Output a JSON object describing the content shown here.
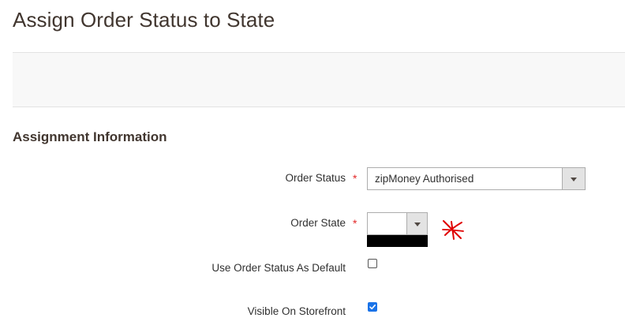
{
  "page": {
    "title": "Assign Order Status to State"
  },
  "section": {
    "title": "Assignment Information"
  },
  "form": {
    "order_status": {
      "label": "Order Status",
      "required_mark": "*",
      "value": "zipMoney Authorised"
    },
    "order_state": {
      "label": "Order State",
      "required_mark": "*",
      "value": ""
    },
    "use_default": {
      "label": "Use Order Status As Default",
      "checked": false
    },
    "visible_storefront": {
      "label": "Visible On Storefront",
      "checked": true
    }
  },
  "colors": {
    "required": "#e22626",
    "annotation": "#e00000",
    "checkbox_checked": "#1a73e8"
  },
  "icons": {
    "dropdown": "chevron-down-icon",
    "annotation": "asterisk-icon"
  }
}
